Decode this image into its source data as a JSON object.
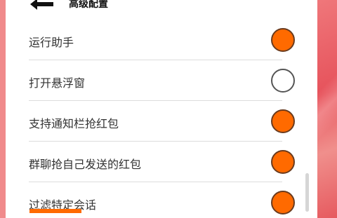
{
  "header": {
    "title": "高级配置",
    "back_icon": "arrow-left-icon"
  },
  "settings": [
    {
      "label": "运行助手",
      "checked": true
    },
    {
      "label": "打开悬浮窗",
      "checked": false
    },
    {
      "label": "支持通知栏抢红包",
      "checked": true
    },
    {
      "label": "群聊抢自己发送的红包",
      "checked": true
    },
    {
      "label": "过滤特定会话",
      "checked": true
    }
  ],
  "colors": {
    "accent": "#ff6a00",
    "background": "#ef6e72"
  }
}
